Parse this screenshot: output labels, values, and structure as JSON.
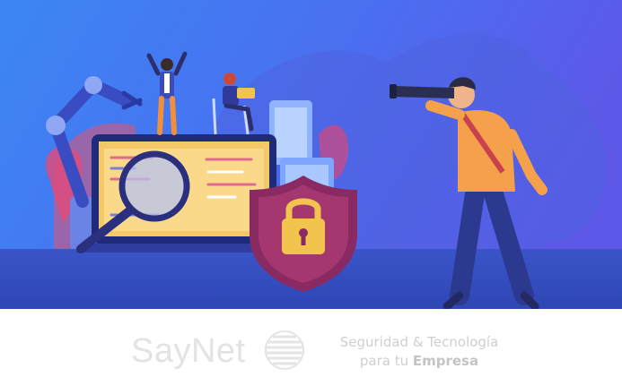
{
  "banner": {
    "brand": {
      "name": "SayNet"
    },
    "tagline": {
      "line1_a": "Seguridad & ",
      "line1_b": "Tecnología",
      "line2_a": "para tu ",
      "line2_b": "Empresa"
    }
  },
  "colors": {
    "bg_top": "#3b7ff2",
    "bg_right": "#5b5ce8",
    "floor": "#3a57c9",
    "shield": "#8a2a63",
    "lock": "#f2c44d",
    "shirt": "#f5a04a",
    "screen": "#f7cf6b",
    "footer_text": "#d0d0d0"
  },
  "icons": [
    "magnifier-icon",
    "shield-lock-icon",
    "telescope-icon",
    "robot-arm-icon",
    "saynet-globe-icon"
  ]
}
